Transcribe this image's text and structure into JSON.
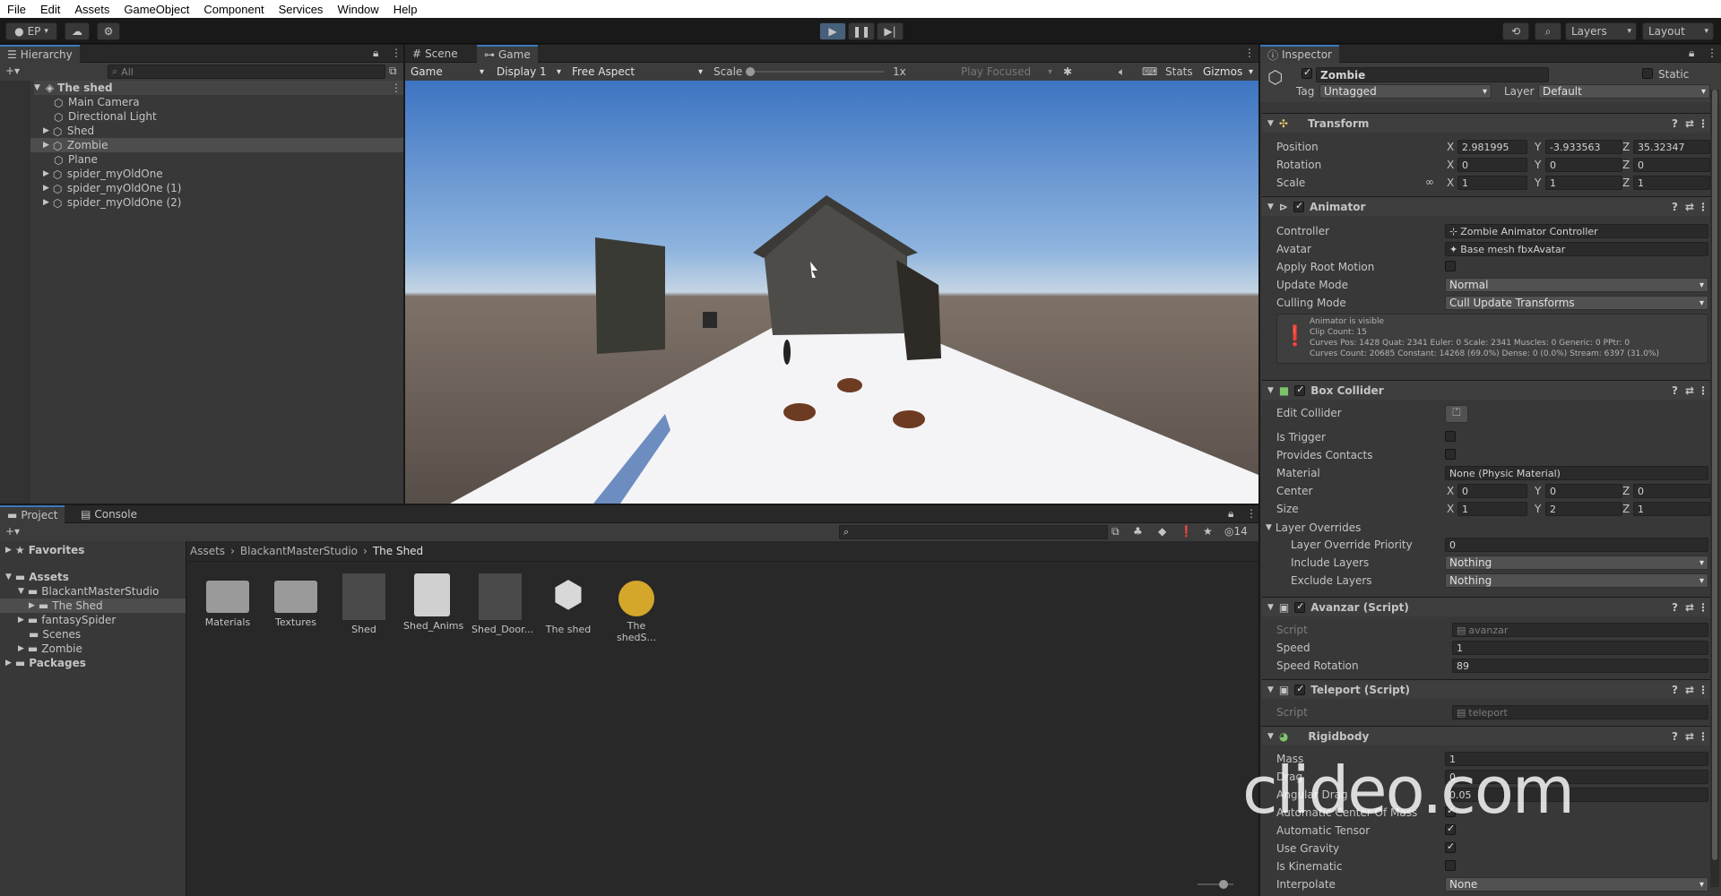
{
  "menu": [
    "File",
    "Edit",
    "Assets",
    "GameObject",
    "Component",
    "Services",
    "Window",
    "Help"
  ],
  "toolbar": {
    "account": "EP",
    "layers": "Layers",
    "layout": "Layout"
  },
  "hierarchy": {
    "tab": "Hierarchy",
    "search_placeholder": "All",
    "scene": "The shed",
    "items": [
      "Main Camera",
      "Directional Light",
      "Shed",
      "Zombie",
      "Plane",
      "spider_myOldOne",
      "spider_myOldOne (1)",
      "spider_myOldOne (2)"
    ]
  },
  "game": {
    "tabs": [
      "Scene",
      "Game"
    ],
    "view": "Game",
    "display": "Display 1",
    "aspect": "Free Aspect",
    "scale_label": "Scale",
    "scale_value": "1x",
    "play_mode": "Play Focused",
    "stats": "Stats",
    "gizmos": "Gizmos"
  },
  "project": {
    "tabs": [
      "Project",
      "Console"
    ],
    "hidden_count": "14",
    "favorites": "Favorites",
    "assets": "Assets",
    "tree": [
      "BlackantMasterStudio",
      "The Shed",
      "fantasySpider",
      "Scenes",
      "Zombie"
    ],
    "packages": "Packages",
    "breadcrumb": [
      "Assets",
      "BlackantMasterStudio",
      "The Shed"
    ],
    "items": [
      "Materials",
      "Textures",
      "Shed",
      "Shed_Anims",
      "Shed_Door...",
      "The shed",
      "The shedS..."
    ]
  },
  "inspector": {
    "tab": "Inspector",
    "object_name": "Zombie",
    "static_label": "Static",
    "tag_label": "Tag",
    "tag": "Untagged",
    "layer_label": "Layer",
    "layer": "Default",
    "transform": {
      "title": "Transform",
      "position_label": "Position",
      "position": [
        "2.981995",
        "-3.933563",
        "35.32347"
      ],
      "rotation_label": "Rotation",
      "rotation": [
        "0",
        "0",
        "0"
      ],
      "scale_label": "Scale",
      "scale": [
        "1",
        "1",
        "1"
      ]
    },
    "animator": {
      "title": "Animator",
      "controller_label": "Controller",
      "controller": "Zombie Animator Controller",
      "avatar_label": "Avatar",
      "avatar": "Base mesh fbxAvatar",
      "apply_root_motion": "Apply Root Motion",
      "update_mode_label": "Update Mode",
      "update_mode": "Normal",
      "culling_mode_label": "Culling Mode",
      "culling_mode": "Cull Update Transforms",
      "info": [
        "Animator is visible",
        "Clip Count: 15",
        "Curves Pos: 1428 Quat: 2341 Euler: 0 Scale: 2341 Muscles: 0 Generic: 0 PPtr: 0",
        "Curves Count: 20685 Constant: 14268 (69.0%) Dense: 0 (0.0%) Stream: 6397 (31.0%)"
      ]
    },
    "box_collider": {
      "title": "Box Collider",
      "edit_collider": "Edit Collider",
      "is_trigger": "Is Trigger",
      "provides_contacts": "Provides Contacts",
      "material_label": "Material",
      "material": "None (Physic Material)",
      "center_label": "Center",
      "center": [
        "0",
        "0",
        "0"
      ],
      "size_label": "Size",
      "size": [
        "1",
        "2",
        "1"
      ],
      "layer_overrides": "Layer Overrides",
      "priority_label": "Layer Override Priority",
      "priority": "0",
      "include_label": "Include Layers",
      "include": "Nothing",
      "exclude_label": "Exclude Layers",
      "exclude": "Nothing"
    },
    "avanzar": {
      "title": "Avanzar (Script)",
      "script_label": "Script",
      "script": "avanzar",
      "speed_label": "Speed",
      "speed": "1",
      "speed_rotation_label": "Speed Rotation",
      "speed_rotation": "89"
    },
    "teleport": {
      "title": "Teleport (Script)",
      "script_label": "Script",
      "script": "teleport"
    },
    "rigidbody": {
      "title": "Rigidbody",
      "mass_label": "Mass",
      "mass": "1",
      "drag_label": "Drag",
      "drag": "0",
      "angular_drag_label": "Angular Drag",
      "angular_drag": "0.05",
      "auto_com": "Automatic Center Of Mass",
      "auto_tensor": "Automatic Tensor",
      "use_gravity": "Use Gravity",
      "is_kinematic": "Is Kinematic",
      "interpolate_label": "Interpolate",
      "interpolate": "None"
    }
  },
  "watermark": "clideo.com",
  "colors": {
    "accent": "#3a79bb",
    "play_active": "#46607c",
    "panel": "#383838"
  }
}
